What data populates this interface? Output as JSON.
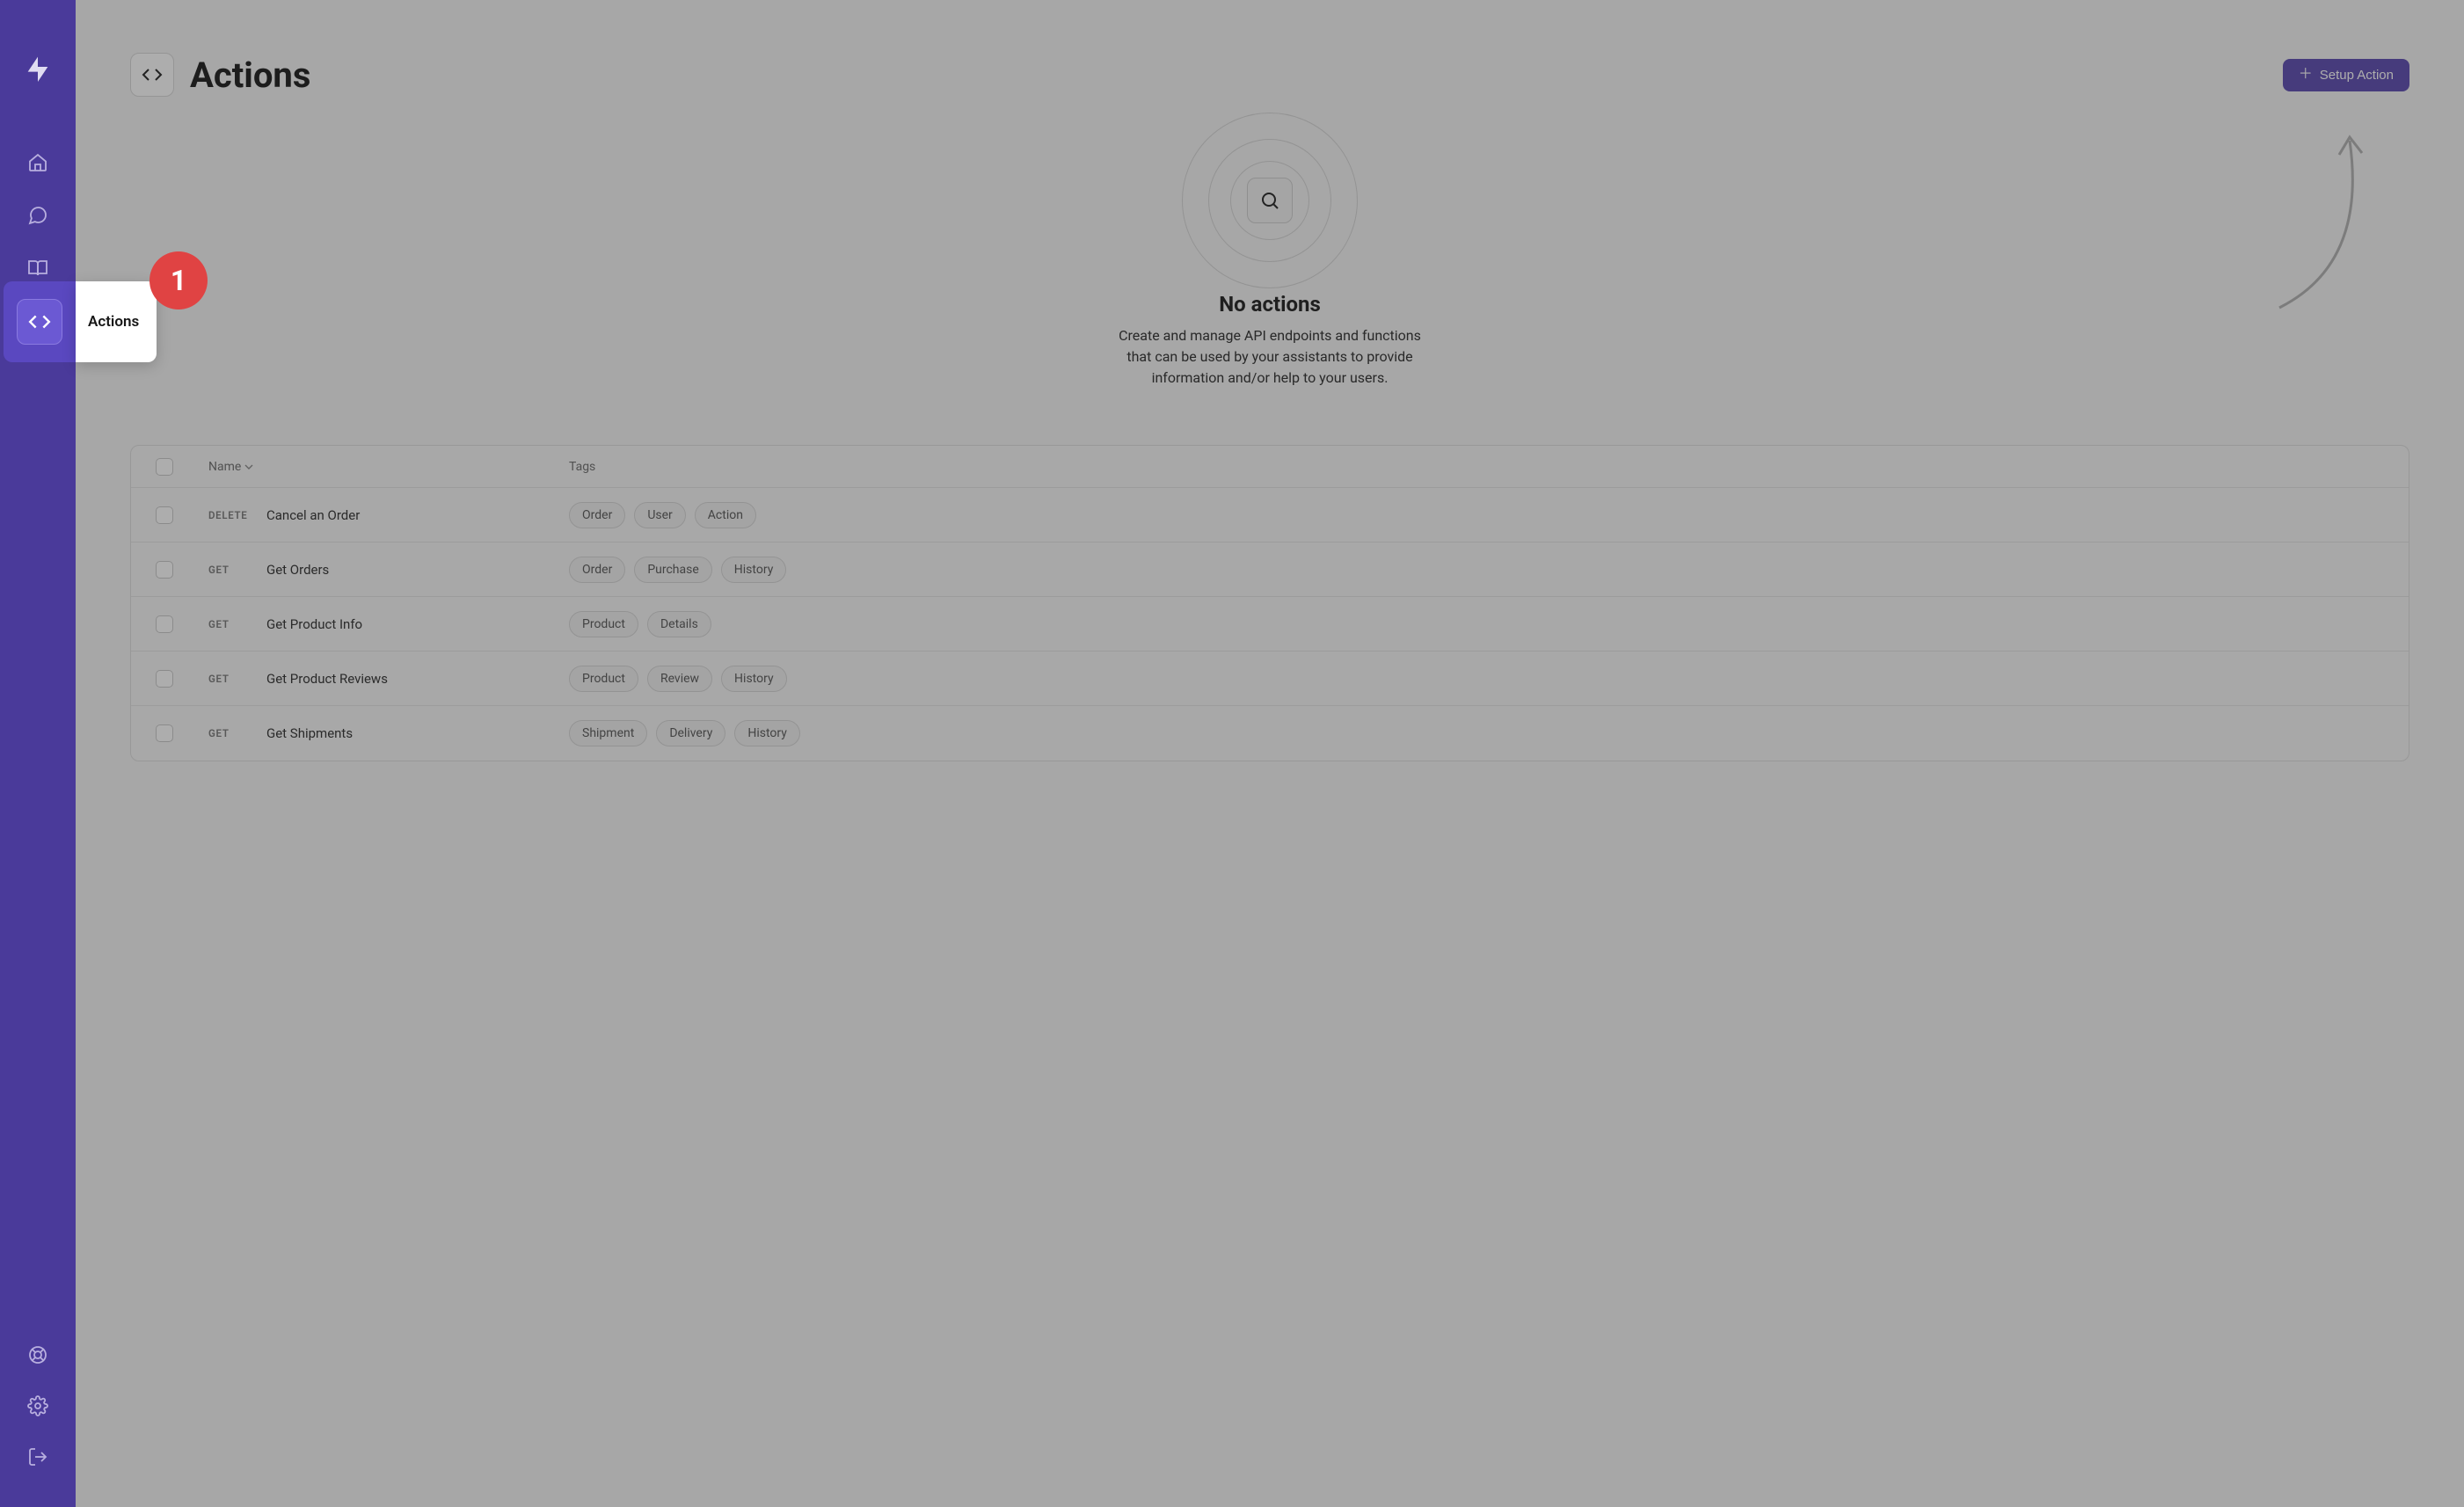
{
  "sidebar": {
    "tooltip_label": "Actions"
  },
  "step_badge": "1",
  "header": {
    "title": "Actions",
    "setup_button": "Setup Action"
  },
  "empty_state": {
    "title": "No actions",
    "description": "Create and manage API endpoints and functions that can be used by your assistants to provide information and/or help to your users."
  },
  "table": {
    "columns": {
      "name": "Name",
      "tags": "Tags"
    },
    "rows": [
      {
        "method": "DELETE",
        "name": "Cancel an Order",
        "tags": [
          "Order",
          "User",
          "Action"
        ]
      },
      {
        "method": "GET",
        "name": "Get Orders",
        "tags": [
          "Order",
          "Purchase",
          "History"
        ]
      },
      {
        "method": "GET",
        "name": "Get Product Info",
        "tags": [
          "Product",
          "Details"
        ]
      },
      {
        "method": "GET",
        "name": "Get Product Reviews",
        "tags": [
          "Product",
          "Review",
          "History"
        ]
      },
      {
        "method": "GET",
        "name": "Get Shipments",
        "tags": [
          "Shipment",
          "Delivery",
          "History"
        ]
      }
    ]
  }
}
